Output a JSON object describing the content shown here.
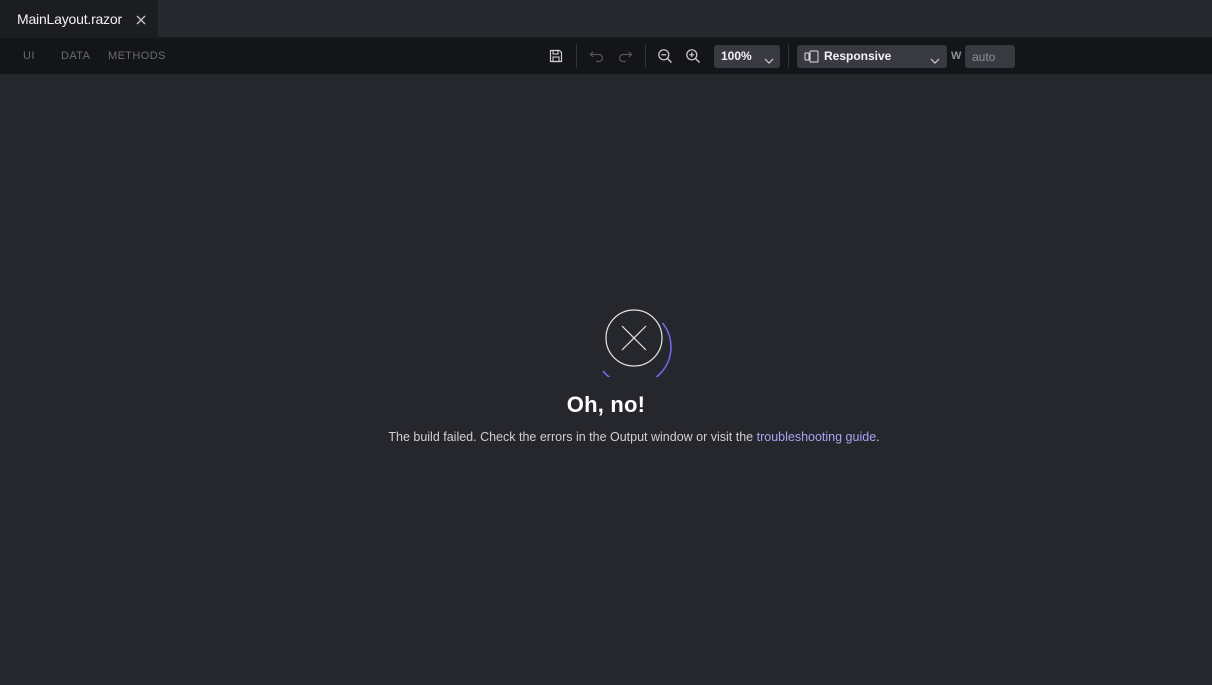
{
  "tab": {
    "label": "MainLayout.razor",
    "close_icon": "close-icon"
  },
  "toolbar": {
    "modes": [
      "UI",
      "DATA",
      "METHODS"
    ],
    "zoom": {
      "value": "100%"
    },
    "device": {
      "value": "Responsive"
    },
    "width": {
      "label": "W",
      "placeholder": "auto"
    },
    "icons": [
      "save-icon",
      "undo-icon",
      "redo-icon",
      "zoom-out-icon",
      "zoom-in-icon",
      "chevron-down-icon",
      "device-icon"
    ]
  },
  "error": {
    "title": "Oh, no!",
    "message_before": "The build failed. Check the errors in the Output window or visit the ",
    "link_text": "troubleshooting guide",
    "message_after": ".",
    "icon": "error-x-icon"
  },
  "colors": {
    "background": "#26272c",
    "toolbar": "#141518",
    "accent": "#7369ef",
    "link": "#a7a4f4"
  }
}
